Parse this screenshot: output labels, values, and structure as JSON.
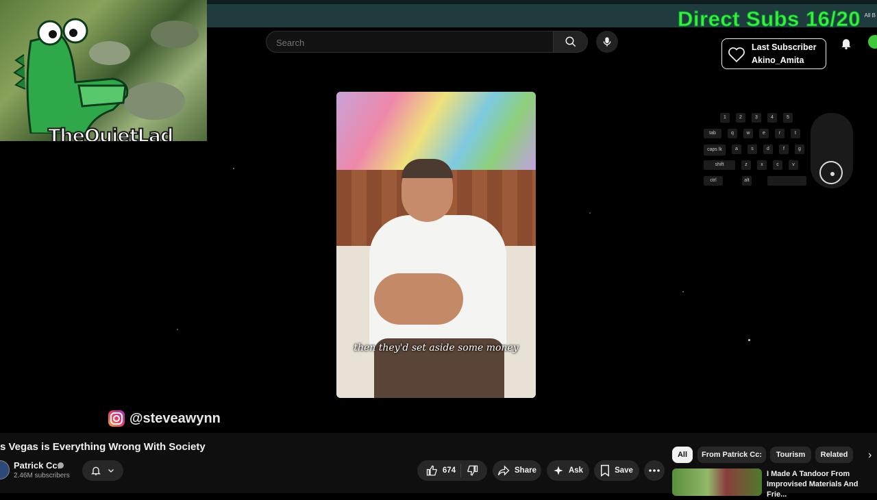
{
  "overlay": {
    "direct_subs": "Direct Subs 16/20",
    "top_right_small": "All B",
    "last_subscriber_title": "Last Subscriber",
    "last_subscriber_name": "Akino_Amita",
    "webcam_name": "TheQuietLad",
    "keyboard": {
      "number_row": [
        "1",
        "2",
        "3",
        "4",
        "5"
      ],
      "row2": [
        "tab",
        "q",
        "w",
        "e",
        "r",
        "t"
      ],
      "row3": [
        "caps lk",
        "a",
        "s",
        "d",
        "f",
        "g"
      ],
      "row4": [
        "shift",
        "z",
        "x",
        "c",
        "v"
      ],
      "row5": [
        "ctrl",
        "alt"
      ]
    }
  },
  "search": {
    "placeholder": "Search"
  },
  "video": {
    "subtitle": "then they'd set aside some money",
    "instagram_handle": "@steveawynn",
    "title": "s Vegas is Everything Wrong With Society"
  },
  "channel": {
    "name": "Patrick Cc:",
    "subscribers": "2.46M subscribers"
  },
  "actions": {
    "like_count": "674",
    "share_label": "Share",
    "ask_label": "Ask",
    "save_label": "Save"
  },
  "chips": {
    "all": "All",
    "from_channel": "From Patrick Cc:",
    "tourism": "Tourism",
    "related": "Related"
  },
  "recommendation": {
    "title": "I Made A Tandoor From Improvised Materials And Frie..."
  },
  "colors": {
    "direct_subs_green": "#3ef03a",
    "top_band": "#1f3b3d",
    "background": "#000000"
  },
  "icons": [
    "search-icon",
    "mic-icon",
    "heart-icon",
    "bell-icon",
    "like-icon",
    "dislike-icon",
    "share-icon",
    "sparkle-icon",
    "save-icon",
    "more-icon",
    "chevron-down-icon",
    "instagram-icon",
    "chevron-right-icon"
  ]
}
